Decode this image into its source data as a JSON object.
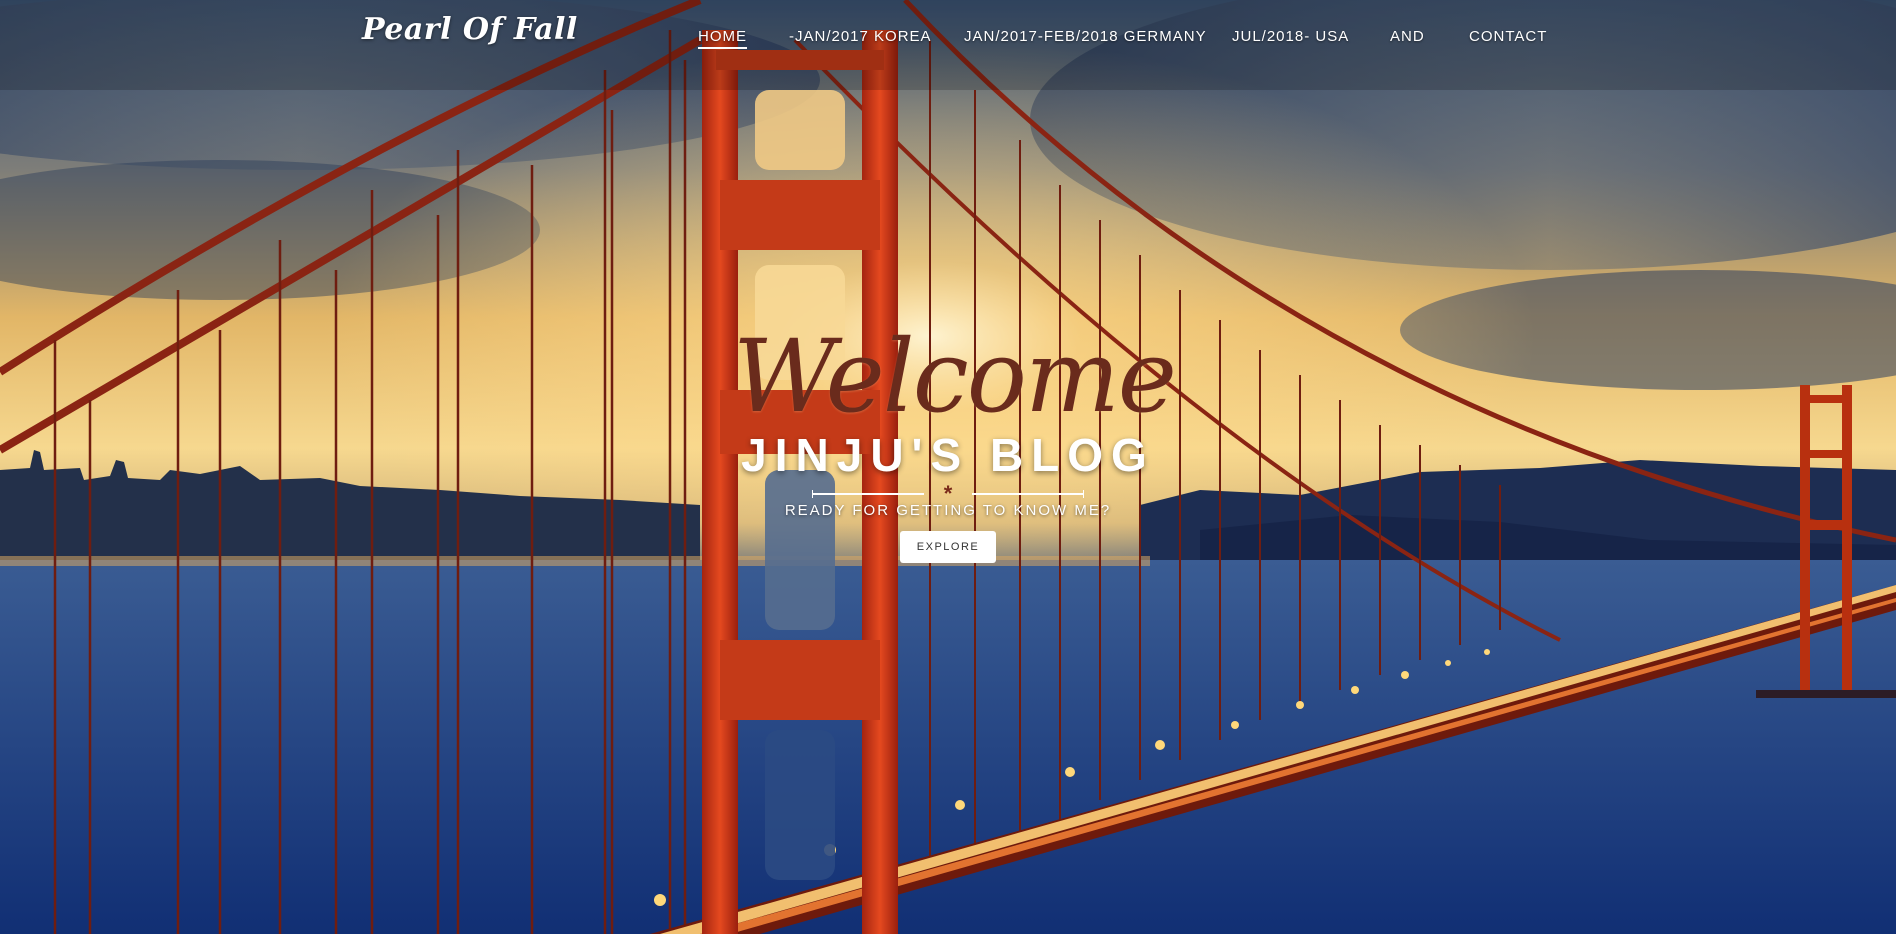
{
  "header": {
    "brand": "Pearl Of Fall",
    "nav": [
      {
        "label": "HOME",
        "active": true
      },
      {
        "label": "-JAN/2017 KOREA",
        "active": false
      },
      {
        "label": "JAN/2017-FEB/2018 GERMANY",
        "active": false
      },
      {
        "label": "JUL/2018- USA",
        "active": false
      },
      {
        "label": "AND",
        "active": false
      },
      {
        "label": "CONTACT",
        "active": false
      }
    ]
  },
  "hero": {
    "script_heading": "Welcome",
    "title": "JINJU'S BLOG",
    "subtitle": "READY FOR GETTING TO KNOW ME?",
    "divider_glyph": "*",
    "button_label": "EXPLORE",
    "background_description": "golden-gate-bridge-sunset-photo"
  },
  "colors": {
    "bridge_red": "#c8321c",
    "welcome_script": "#6a2b1c",
    "sky_gold": "#f3c468",
    "water_blue": "#1c4690"
  }
}
